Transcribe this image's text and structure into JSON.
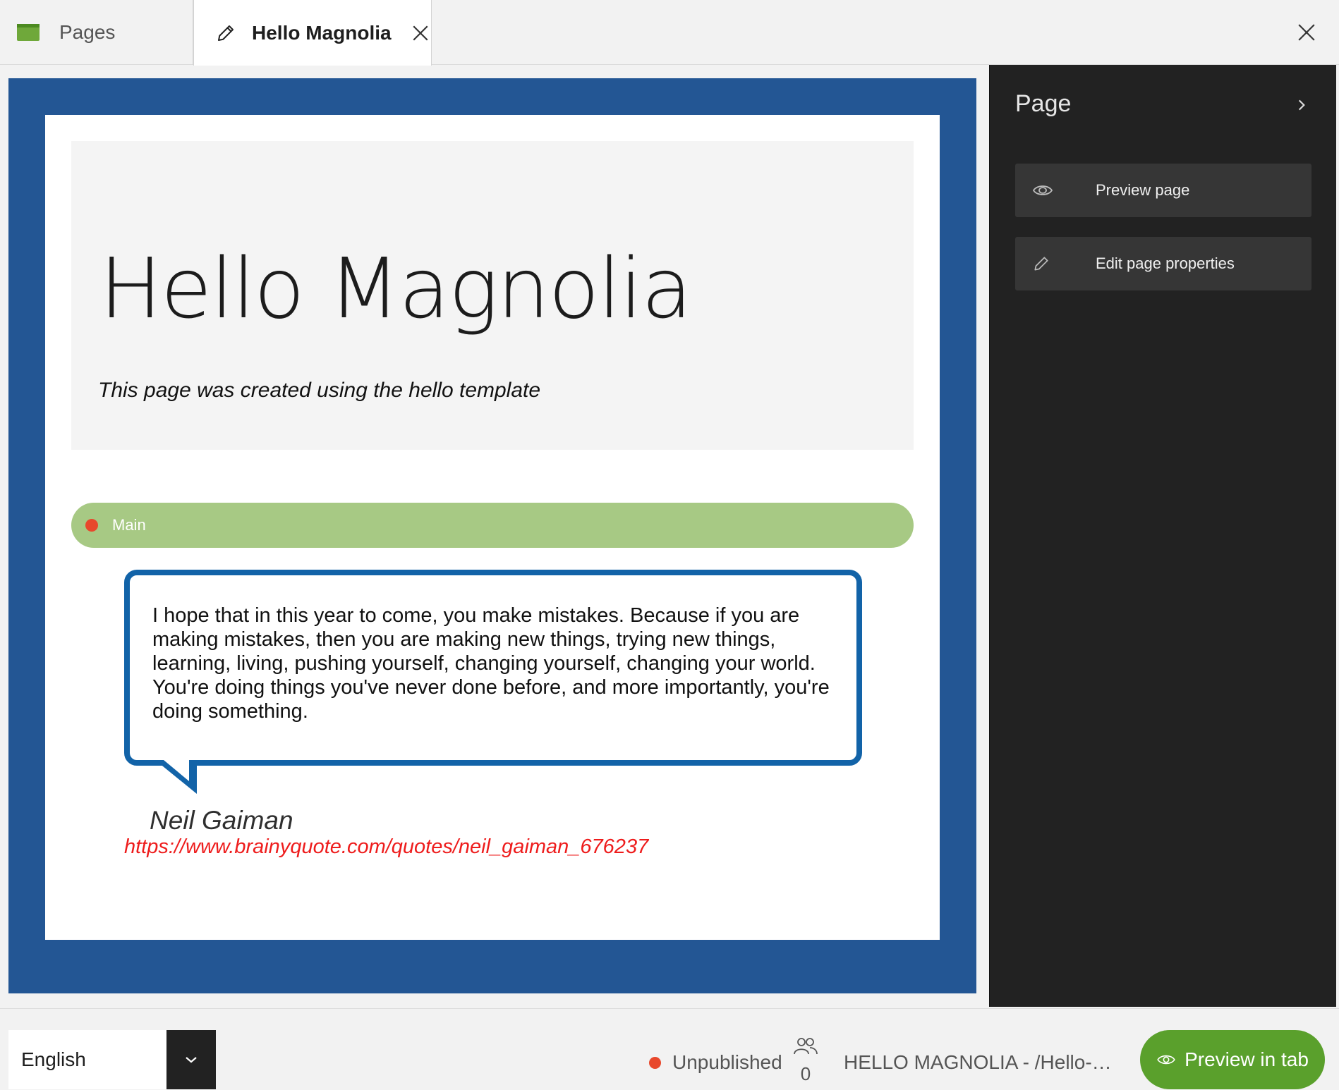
{
  "tabs": {
    "pages_label": "Pages",
    "editor_label": "Hello Magnolia"
  },
  "page": {
    "title": "Hello Magnolia",
    "subtitle": "This page was created using the hello template",
    "area_label": "Main",
    "quote_text": "I hope that in this year to come, you make mistakes. Because if you are making mistakes, then you are making new things, trying new things, learning, living, pushing yourself, changing yourself, changing your world. You're doing things you've never done before, and more importantly, you're doing something.",
    "quote_author": "Neil Gaiman",
    "quote_link": "https://www.brainyquote.com/quotes/neil_gaiman_676237"
  },
  "side_panel": {
    "title": "Page",
    "actions": [
      {
        "label": "Preview page",
        "icon": "eye-icon"
      },
      {
        "label": "Edit page properties",
        "icon": "pencil-icon"
      }
    ]
  },
  "footer": {
    "language": "English",
    "status": "Unpublished",
    "user_count": "0",
    "page_path": "HELLO MAGNOLIA - /Hello-Ma...",
    "preview_tab_label": "Preview in tab"
  },
  "colors": {
    "canvas_border": "#235694",
    "area_bar": "#a7c984",
    "status_dot": "#e8482c",
    "quote_border": "#1263a8",
    "link": "#ee1c1c",
    "accent_green": "#5aa02c",
    "panel_bg": "#222222"
  }
}
